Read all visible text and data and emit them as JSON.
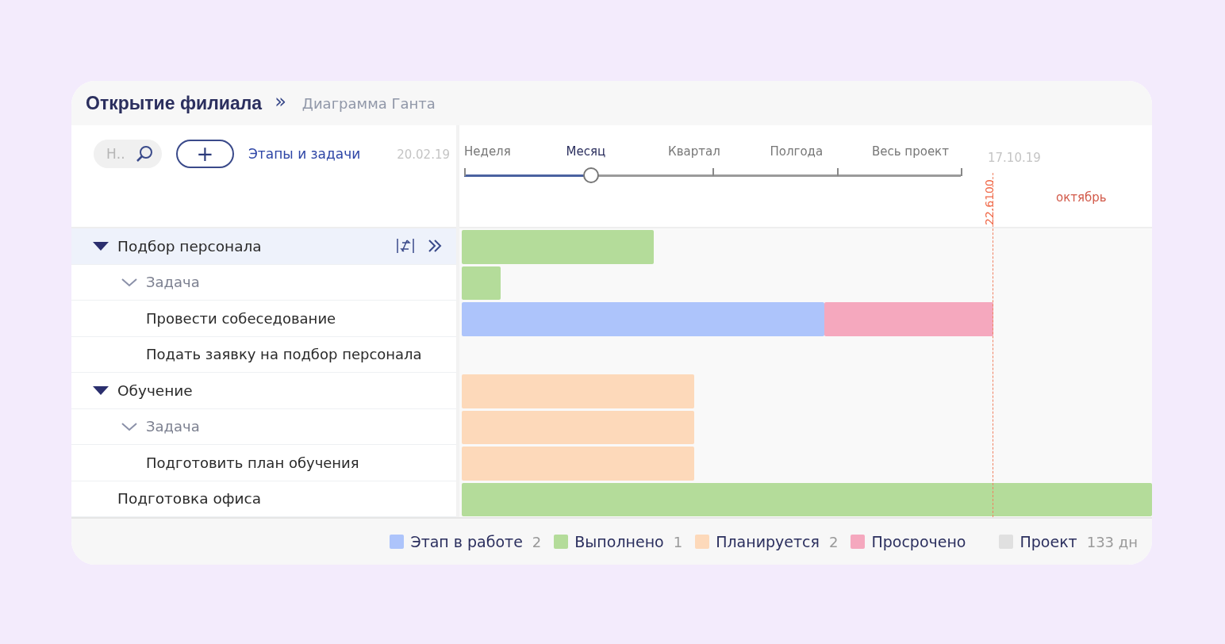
{
  "breadcrumb": {
    "project": "Открытие филиала",
    "separator": "»",
    "page": "Диаграмма Ганта"
  },
  "toolbar": {
    "search": {
      "placeholder": "Н.."
    },
    "add_label": "+",
    "view_link": "Этапы и задачи",
    "start_date": "20.02.19",
    "end_date": "17.10.19"
  },
  "scale": {
    "options": [
      {
        "label": "Неделя",
        "selected": false
      },
      {
        "label": "Месяц",
        "selected": true
      },
      {
        "label": "Квартал",
        "selected": false
      },
      {
        "label": "Полгода",
        "selected": false
      },
      {
        "label": "Весь проект",
        "selected": false
      }
    ],
    "level": 0.255
  },
  "timeline": {
    "month": "октябрь",
    "today_marker": "22.6100"
  },
  "tree": [
    {
      "label": "Подбор персонала",
      "kind": "stage",
      "expanded": true,
      "selected": true,
      "bars": [
        {
          "kind": "done"
        }
      ],
      "children": [
        {
          "label": "Задача",
          "kind": "group",
          "expanded": true,
          "selected": false,
          "bars": [
            {
              "kind": "done"
            }
          ],
          "children": [
            {
              "label": "Провести собеседование",
              "kind": "task",
              "selected": false,
              "bars": [
                {
                  "kind": "progress"
                },
                {
                  "kind": "overdue"
                }
              ]
            },
            {
              "label": "Подать  заявку на подбор персонала",
              "kind": "task",
              "selected": false
            }
          ]
        }
      ]
    },
    {
      "label": "Обучение",
      "kind": "stage",
      "expanded": true,
      "selected": false,
      "bars": [
        {
          "kind": "planned"
        }
      ],
      "children": [
        {
          "label": "Задача",
          "kind": "group",
          "expanded": true,
          "selected": false,
          "bars": [
            {
              "kind": "planned"
            }
          ],
          "children": [
            {
              "label": "Подготовить план обучения",
              "kind": "task",
              "selected": false,
              "bars": [
                {
                  "kind": "planned"
                }
              ]
            }
          ]
        }
      ]
    },
    {
      "label": "Подготовка офиса",
      "kind": "plain",
      "selected": false,
      "bars": [
        {
          "kind": "done"
        }
      ]
    }
  ],
  "legend": [
    {
      "kind": "progress",
      "label": "Этап в работе",
      "count": "2",
      "color": "#adc4fb"
    },
    {
      "kind": "done",
      "label": "Выполнено",
      "count": "1",
      "color": "#b4dc9a"
    },
    {
      "kind": "planned",
      "label": "Планируется",
      "count": "2",
      "color": "#fdd9ba"
    },
    {
      "kind": "overdue",
      "label": "Просрочено",
      "color": "#f5a8be"
    },
    {
      "kind": "project",
      "label": "Проект",
      "count": "133 дн",
      "color": "#e0e0e0"
    }
  ]
}
